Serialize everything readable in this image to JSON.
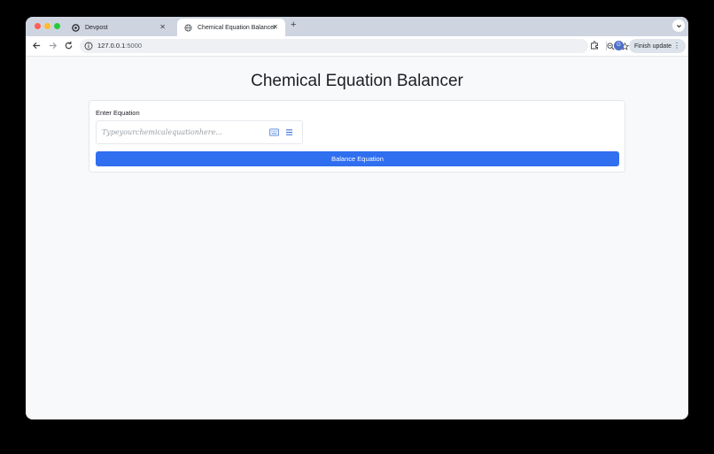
{
  "tabs": [
    {
      "title": "Devpost",
      "icon": "devpost-icon"
    },
    {
      "title": "Chemical Equation Balancer",
      "icon": "globe-icon",
      "active": true
    }
  ],
  "toolbar": {
    "url_host": "127.0.0.1",
    "url_port": ":5000",
    "profile_initial": "G",
    "finish_update_label": "Finish update"
  },
  "page": {
    "heading": "Chemical Equation Balancer",
    "form": {
      "label": "Enter Equation",
      "placeholder": "Typeyourchemicalequationhere...",
      "submit_label": "Balance Equation"
    }
  },
  "colors": {
    "accent": "#2f6ff0",
    "page_bg": "#f8f9fb",
    "tabstrip_bg": "#cfd5e0"
  }
}
